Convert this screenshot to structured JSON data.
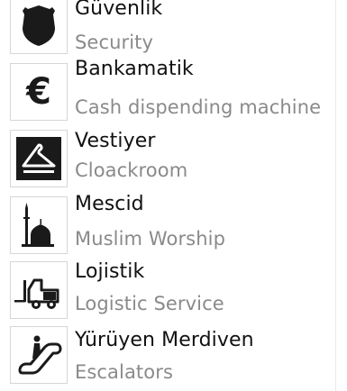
{
  "items": [
    {
      "icon": "shield-icon",
      "title": "Güvenlik",
      "subtitle": "Security"
    },
    {
      "icon": "euro-icon",
      "title": "Bankamatik",
      "subtitle": "Cash dispending machine"
    },
    {
      "icon": "hanger-icon",
      "title": "Vestiyer",
      "subtitle": "Cloackroom"
    },
    {
      "icon": "mosque-icon",
      "title": "Mescid",
      "subtitle": "Muslim Worship"
    },
    {
      "icon": "forklift-icon",
      "title": "Lojistik",
      "subtitle": "Logistic Service"
    },
    {
      "icon": "escalator-icon",
      "title": "Yürüyen Merdiven",
      "subtitle": "Escalators"
    }
  ],
  "colors": {
    "title": "#111111",
    "subtitle": "#8a8a8a",
    "icon": "#1a1a1a",
    "border": "#d6d6d6"
  }
}
